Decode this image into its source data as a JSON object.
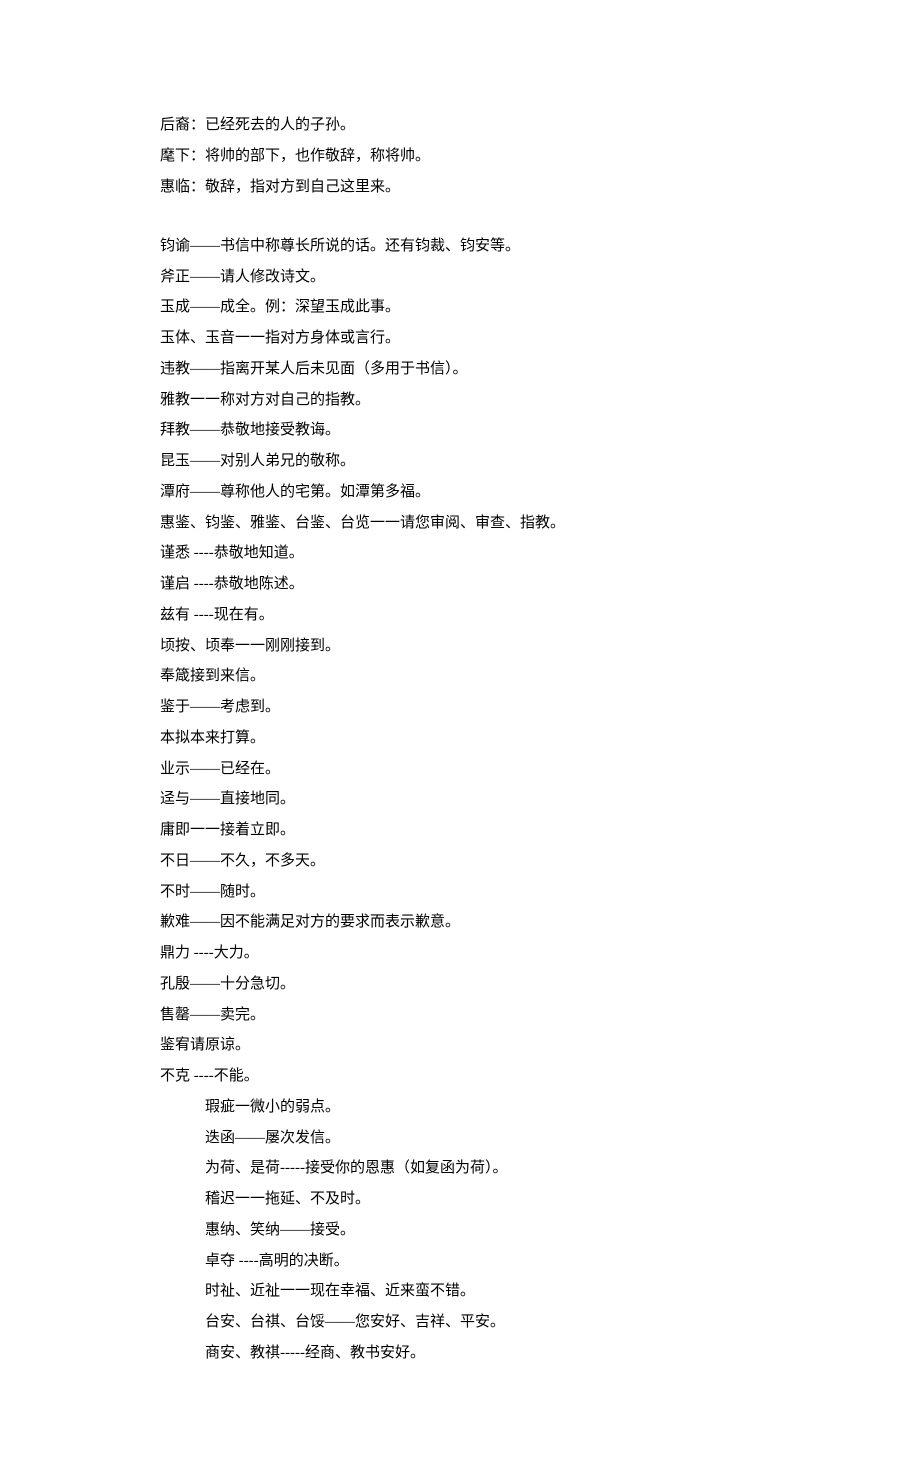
{
  "lines": [
    {
      "text": "后裔：已经死去的人的子孙。",
      "indent": false
    },
    {
      "text": "麾下：将帅的部下，也作敬辞，称将帅。",
      "indent": false
    },
    {
      "text": "惠临：敬辞，指对方到自己这里来。",
      "indent": false
    },
    {
      "gap": true
    },
    {
      "text": "钧谕——书信中称尊长所说的话。还有钧裁、钧安等。",
      "indent": false
    },
    {
      "text": "斧正——请人修改诗文。",
      "indent": false
    },
    {
      "text": "玉成——成全。例：深望玉成此事。",
      "indent": false
    },
    {
      "text": "玉体、玉音一一指对方身体或言行。",
      "indent": false
    },
    {
      "text": "违教——指离开某人后未见面（多用于书信）。",
      "indent": false
    },
    {
      "text": "雅教一一称对方对自己的指教。",
      "indent": false
    },
    {
      "text": "拜教——恭敬地接受教诲。",
      "indent": false
    },
    {
      "text": "昆玉——对别人弟兄的敬称。",
      "indent": false
    },
    {
      "text": "潭府——尊称他人的宅第。如潭第多福。",
      "indent": false
    },
    {
      "text": "惠鉴、钧鉴、雅鉴、台鉴、台览一一请您审阅、审查、指教。",
      "indent": false
    },
    {
      "text": "谨悉 ----恭敬地知道。",
      "indent": false
    },
    {
      "text": "谨启 ----恭敬地陈述。",
      "indent": false
    },
    {
      "text": "兹有 ----现在有。",
      "indent": false
    },
    {
      "text": "顷按、顷奉一一刚刚接到。",
      "indent": false
    },
    {
      "text": "奉箴接到来信。",
      "indent": false
    },
    {
      "text": "鉴于——考虑到。",
      "indent": false
    },
    {
      "text": "本拟本来打算。",
      "indent": false
    },
    {
      "text": "业示——已经在。",
      "indent": false
    },
    {
      "text": "迳与——直接地同。",
      "indent": false
    },
    {
      "text": "庸即一一接着立即。",
      "indent": false
    },
    {
      "text": "不日——不久，不多天。",
      "indent": false
    },
    {
      "text": "不时——随时。",
      "indent": false
    },
    {
      "text": "歉难——因不能满足对方的要求而表示歉意。",
      "indent": false
    },
    {
      "text": "鼎力 ----大力。",
      "indent": false
    },
    {
      "text": "孔殷——十分急切。",
      "indent": false
    },
    {
      "text": "售罄——卖完。",
      "indent": false
    },
    {
      "text": "鉴宥请原谅。",
      "indent": false
    },
    {
      "text": "不克 ----不能。",
      "indent": false
    },
    {
      "text": "瑕疵一微小的弱点。",
      "indent": true
    },
    {
      "text": "迭函——屡次发信。",
      "indent": true
    },
    {
      "text": "为荷、是荷-----接受你的恩惠（如复函为荷）。",
      "indent": true
    },
    {
      "text": "稽迟一一拖延、不及时。",
      "indent": true
    },
    {
      "text": "惠纳、笑纳——接受。",
      "indent": true
    },
    {
      "text": "卓夺 ----高明的决断。",
      "indent": true
    },
    {
      "text": "时祉、近祉一一现在幸福、近来蛮不错。",
      "indent": true
    },
    {
      "text": "台安、台祺、台馁——您安好、吉祥、平安。",
      "indent": true
    },
    {
      "text": "商安、教祺-----经商、教书安好。",
      "indent": true
    }
  ]
}
